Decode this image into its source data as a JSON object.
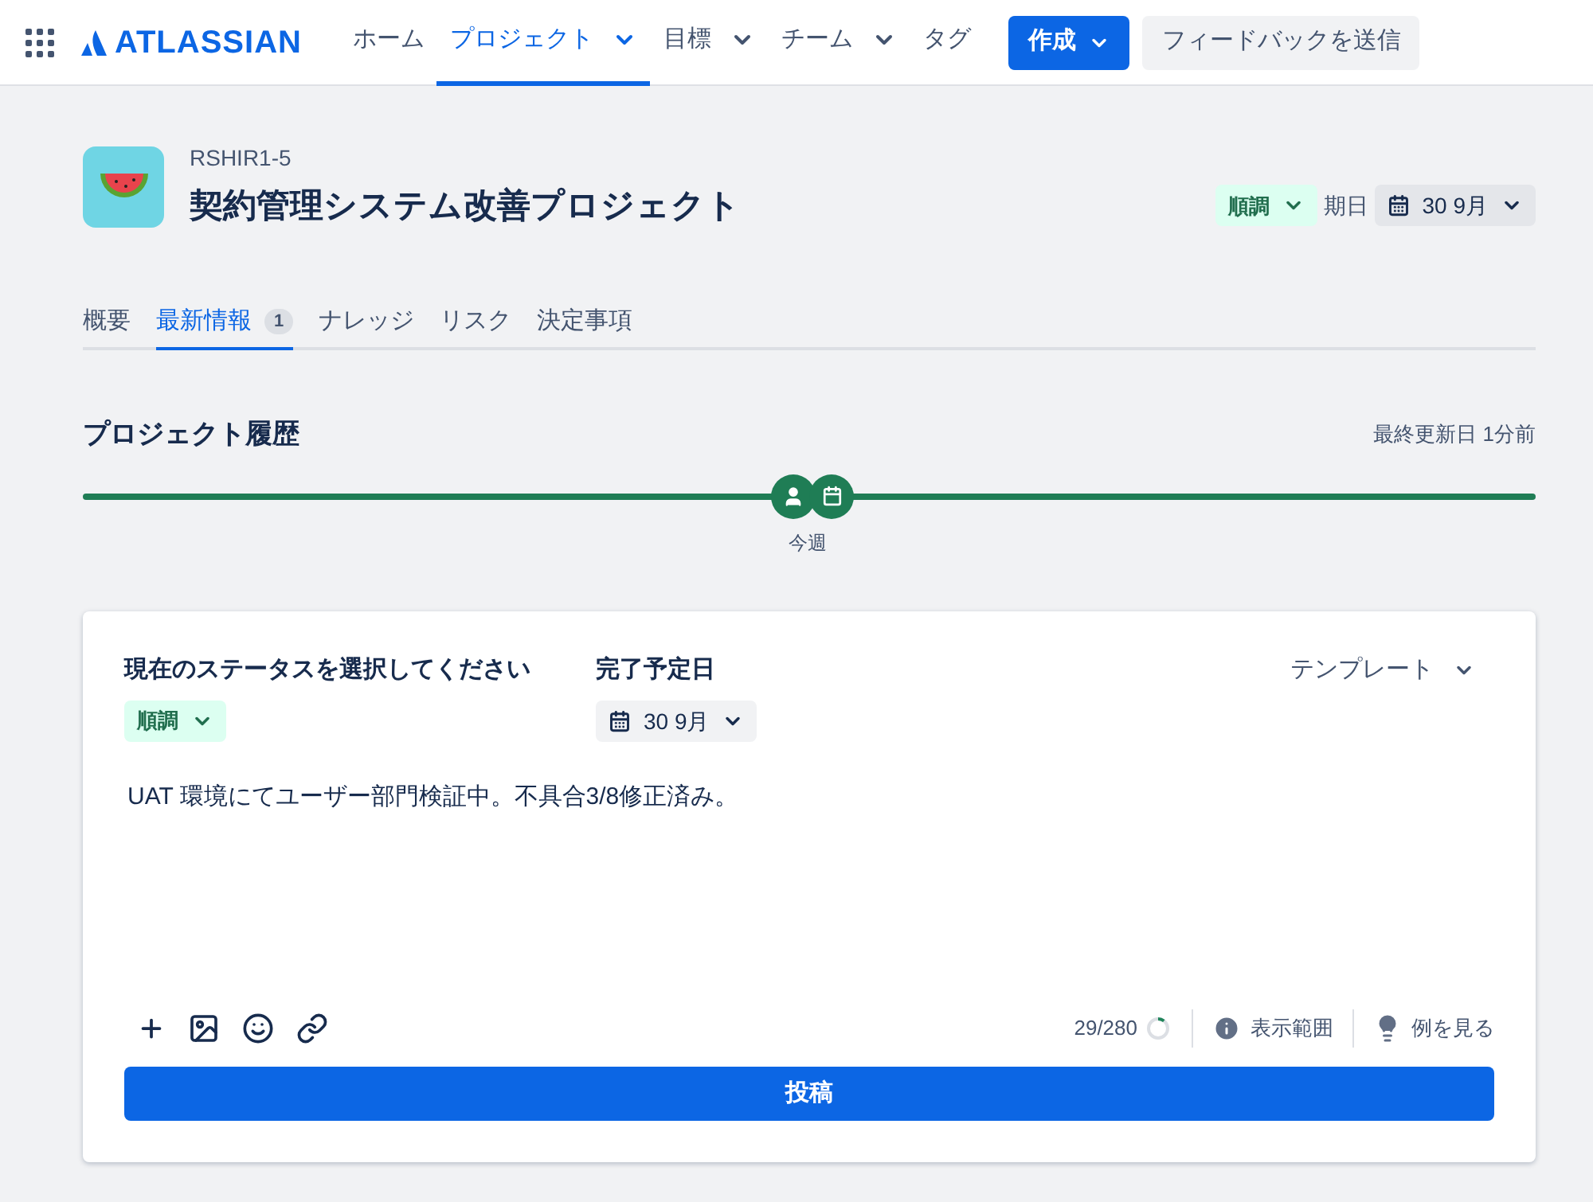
{
  "nav": {
    "brand": "ATLASSIAN",
    "items": [
      {
        "label": "ホーム",
        "selected": false,
        "menu": false
      },
      {
        "label": "プロジェクト",
        "selected": true,
        "menu": true
      },
      {
        "label": "目標",
        "selected": false,
        "menu": true
      },
      {
        "label": "チーム",
        "selected": false,
        "menu": true
      },
      {
        "label": "タグ",
        "selected": false,
        "menu": false
      }
    ],
    "create": "作成",
    "feedback": "フィードバックを送信"
  },
  "project": {
    "key": "RSHIR1-5",
    "title": "契約管理システム改善プロジェクト",
    "status": "順調",
    "due_label": "期日",
    "due": "30 9月"
  },
  "tabs": [
    {
      "label": "概要",
      "selected": false
    },
    {
      "label": "最新情報",
      "selected": true,
      "badge": "1"
    },
    {
      "label": "ナレッジ",
      "selected": false
    },
    {
      "label": "リスク",
      "selected": false
    },
    {
      "label": "決定事項",
      "selected": false
    }
  ],
  "history": {
    "title": "プロジェクト履歴",
    "updated": "最終更新日 1分前",
    "marker": "今週"
  },
  "update": {
    "status_label": "現在のステータスを選択してください",
    "status": "順調",
    "date_label": "完了予定日",
    "date": "30 9月",
    "template": "テンプレート",
    "text": "UAT 環境にてユーザー部門検証中。不具合3/8修正済み。",
    "count": "29/280",
    "count_ring": {
      "level": 0.104
    },
    "visibility": "表示範囲",
    "examples": "例を見る",
    "post": "投稿"
  }
}
